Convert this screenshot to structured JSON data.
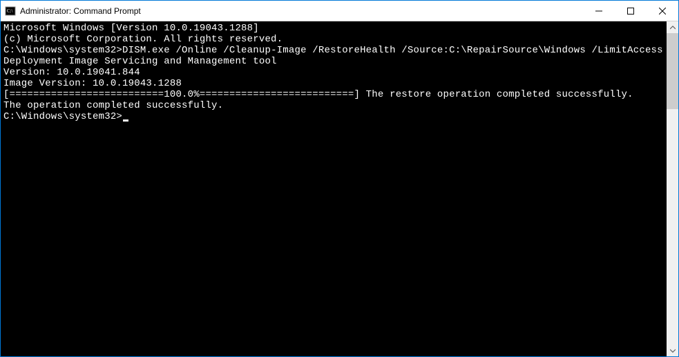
{
  "window": {
    "title": "Administrator: Command Prompt"
  },
  "console": {
    "line1": "Microsoft Windows [Version 10.0.19043.1288]",
    "line2": "(c) Microsoft Corporation. All rights reserved.",
    "blank1": "",
    "prompt1_path": "C:\\Windows\\system32>",
    "prompt1_cmd": "DISM.exe /Online /Cleanup-Image /RestoreHealth /Source:C:\\RepairSource\\Windows /LimitAccess",
    "blank2": "",
    "tool_line1": "Deployment Image Servicing and Management tool",
    "tool_line2": "Version: 10.0.19041.844",
    "blank3": "",
    "image_version": "Image Version: 10.0.19043.1288",
    "blank4": "",
    "progress_line": "[==========================100.0%==========================] The restore operation completed successfully.",
    "completion_line": "The operation completed successfully.",
    "blank5": "",
    "prompt2_path": "C:\\Windows\\system32>"
  }
}
